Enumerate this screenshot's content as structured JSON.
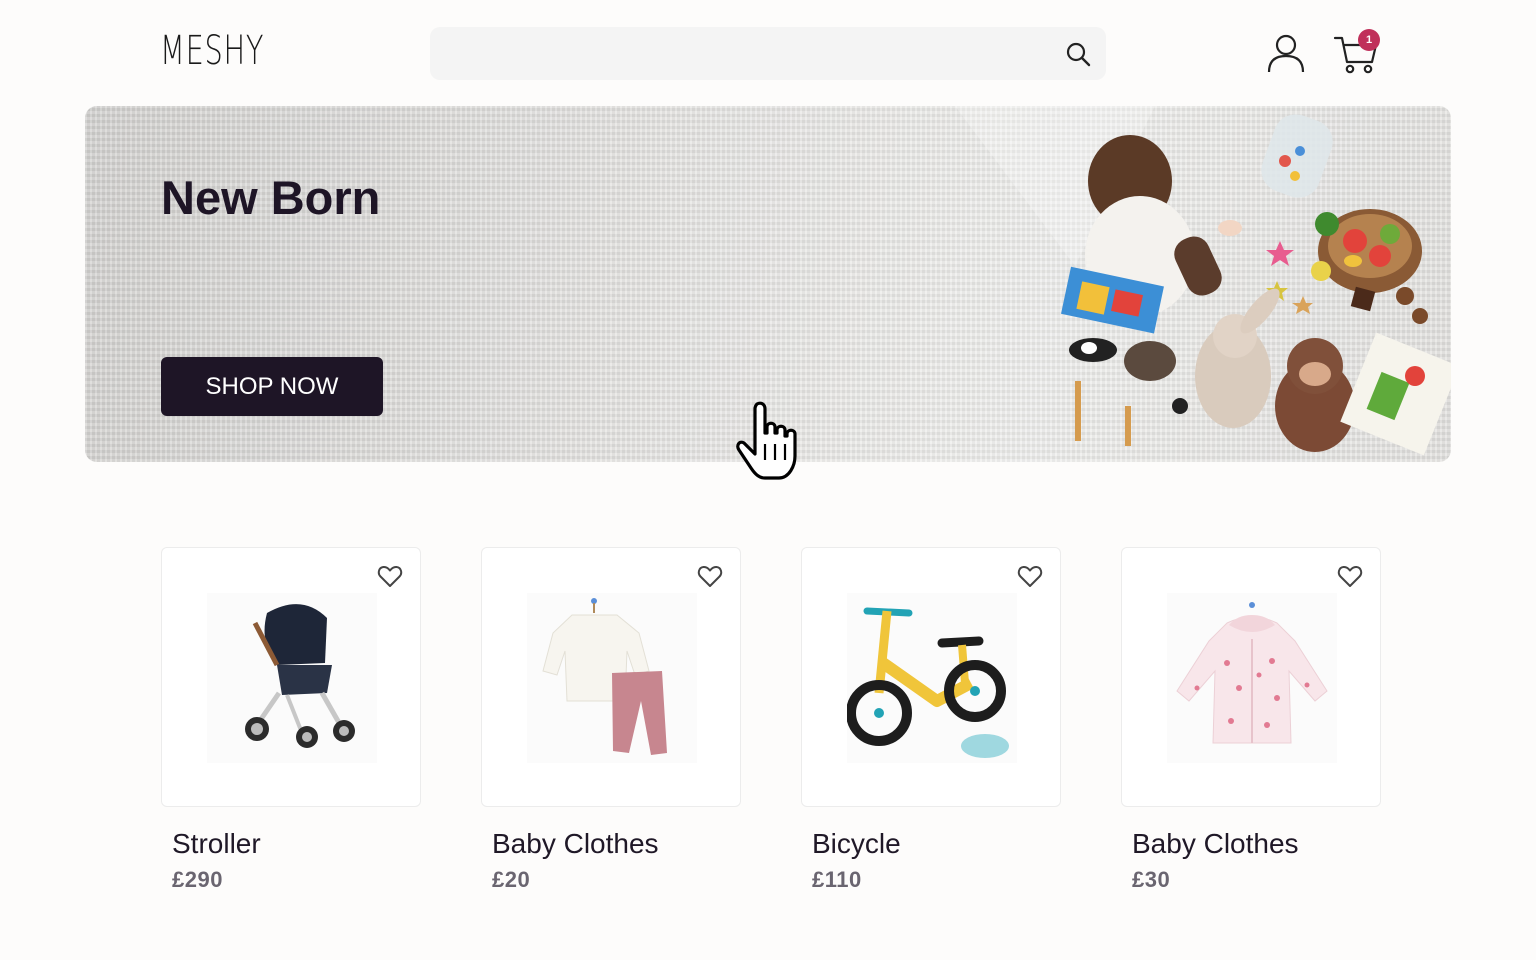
{
  "header": {
    "logo_text": "MESHY",
    "search": {
      "placeholder": ""
    },
    "cart_count": "1"
  },
  "hero": {
    "title": "New Born",
    "cta_label": "SHOP NOW"
  },
  "products": [
    {
      "name": "Stroller",
      "price": "£290",
      "image": "stroller"
    },
    {
      "name": "Baby Clothes",
      "price": "£20",
      "image": "baby-outfit"
    },
    {
      "name": "Bicycle",
      "price": "£110",
      "image": "balance-bike"
    },
    {
      "name": "Baby Clothes",
      "price": "£30",
      "image": "floral-jacket"
    }
  ],
  "colors": {
    "brand_dark": "#1e1526",
    "badge": "#c0305a",
    "price_gray": "#6a6570"
  },
  "icons": [
    "search-icon",
    "user-icon",
    "cart-icon",
    "heart-icon",
    "pointer-cursor-icon"
  ]
}
